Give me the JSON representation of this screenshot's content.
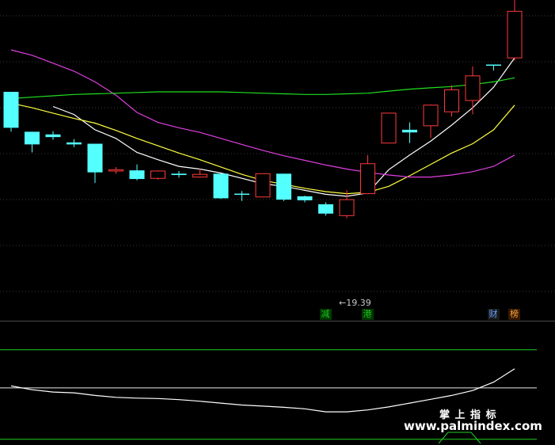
{
  "chart_data": {
    "type": "candlestick",
    "price_ylim": [
      19.0,
      23.7
    ],
    "candles": [
      {
        "o": 22.32,
        "c": 21.78,
        "h": 22.32,
        "l": 21.72
      },
      {
        "o": 21.72,
        "c": 21.53,
        "h": 21.72,
        "l": 21.41
      },
      {
        "o": 21.68,
        "c": 21.64,
        "h": 21.73,
        "l": 21.6
      },
      {
        "o": 21.56,
        "c": 21.53,
        "h": 21.61,
        "l": 21.49
      },
      {
        "o": 21.54,
        "c": 21.11,
        "h": 21.54,
        "l": 20.95
      },
      {
        "o": 21.13,
        "c": 21.15,
        "h": 21.19,
        "l": 21.09
      },
      {
        "o": 21.14,
        "c": 21.01,
        "h": 21.23,
        "l": 20.99
      },
      {
        "o": 21.02,
        "c": 21.13,
        "h": 21.14,
        "l": 21.0
      },
      {
        "o": 21.09,
        "c": 21.07,
        "h": 21.13,
        "l": 21.03
      },
      {
        "o": 21.04,
        "c": 21.08,
        "h": 21.17,
        "l": 21.03
      },
      {
        "o": 21.09,
        "c": 20.72,
        "h": 21.09,
        "l": 20.71
      },
      {
        "o": 20.79,
        "c": 20.78,
        "h": 20.83,
        "l": 20.68
      },
      {
        "o": 20.74,
        "c": 21.09,
        "h": 21.09,
        "l": 20.74
      },
      {
        "o": 21.09,
        "c": 20.7,
        "h": 21.09,
        "l": 20.68
      },
      {
        "o": 20.75,
        "c": 20.69,
        "h": 20.76,
        "l": 20.66
      },
      {
        "o": 20.63,
        "c": 20.49,
        "h": 20.66,
        "l": 20.46
      },
      {
        "o": 20.46,
        "c": 20.7,
        "h": 20.84,
        "l": 20.42
      },
      {
        "o": 20.79,
        "c": 21.24,
        "h": 21.37,
        "l": 20.79
      },
      {
        "o": 21.55,
        "c": 22.0,
        "h": 22.0,
        "l": 21.55
      },
      {
        "o": 21.75,
        "c": 21.71,
        "h": 21.86,
        "l": 21.55
      },
      {
        "o": 21.81,
        "c": 22.12,
        "h": 22.13,
        "l": 21.63
      },
      {
        "o": 22.02,
        "c": 22.35,
        "h": 22.42,
        "l": 21.95
      },
      {
        "o": 22.19,
        "c": 22.56,
        "h": 22.7,
        "l": 21.98
      },
      {
        "o": 22.73,
        "c": 22.72,
        "h": 22.73,
        "l": 22.64
      },
      {
        "o": 22.83,
        "c": 23.53,
        "h": 23.76,
        "l": 22.79
      }
    ],
    "ma_series": [
      {
        "color": "#ffffff",
        "values": [
          null,
          null,
          22.1,
          21.98,
          21.75,
          21.62,
          21.41,
          21.3,
          21.2,
          21.16,
          21.1,
          21.02,
          20.94,
          20.9,
          20.84,
          20.78,
          20.75,
          20.8,
          21.15,
          21.37,
          21.58,
          21.82,
          22.08,
          22.39,
          22.83
        ]
      },
      {
        "color": "#ffff40",
        "values": [
          22.15,
          22.08,
          22.0,
          21.92,
          21.85,
          21.74,
          21.62,
          21.51,
          21.4,
          21.3,
          21.19,
          21.08,
          20.99,
          20.93,
          20.87,
          20.82,
          20.79,
          20.81,
          20.9,
          21.06,
          21.23,
          21.4,
          21.54,
          21.75,
          22.12
        ]
      },
      {
        "color": "#e040e0",
        "values": [
          22.95,
          22.87,
          22.75,
          22.63,
          22.47,
          22.27,
          22.01,
          21.86,
          21.78,
          21.71,
          21.62,
          21.53,
          21.44,
          21.36,
          21.29,
          21.22,
          21.16,
          21.11,
          21.07,
          21.04,
          21.04,
          21.07,
          21.12,
          21.2,
          21.37
        ]
      },
      {
        "color": "#20e020",
        "values": [
          22.22,
          22.24,
          22.26,
          22.28,
          22.29,
          22.3,
          22.31,
          22.32,
          22.32,
          22.32,
          22.32,
          22.31,
          22.3,
          22.29,
          22.28,
          22.28,
          22.29,
          22.3,
          22.33,
          22.36,
          22.38,
          22.4,
          22.43,
          22.47,
          22.53
        ]
      }
    ],
    "low_annotation": {
      "index": 16,
      "price": 19.39,
      "text": "←19.39"
    },
    "markers": [
      {
        "index": 15,
        "text": "减",
        "color": "#20c020",
        "bg": "#003800"
      },
      {
        "index": 17,
        "text": "港",
        "color": "#20c020",
        "bg": "#003800"
      },
      {
        "index": 23,
        "text": "财",
        "color": "#6aa0ff",
        "bg": "#1a1a1a"
      },
      {
        "index": 24,
        "text": "榜",
        "color": "#ffa040",
        "bg": "#331a00"
      }
    ],
    "indicator": {
      "white_line": [
        0.6,
        0.5,
        0.44,
        0.42,
        0.35,
        0.3,
        0.28,
        0.27,
        0.24,
        0.2,
        0.15,
        0.1,
        0.07,
        0.04,
        0.0,
        -0.08,
        -0.08,
        -0.03,
        0.05,
        0.15,
        0.25,
        0.35,
        0.48,
        0.7,
        1.05
      ],
      "levels": {
        "upper": 1.55,
        "middle": 0.55,
        "lower": -0.8
      },
      "ylim": [
        -0.95,
        2.25
      ]
    }
  },
  "watermark": {
    "line1": "掌 上 指 标",
    "line2": "www.palmindex.com"
  }
}
